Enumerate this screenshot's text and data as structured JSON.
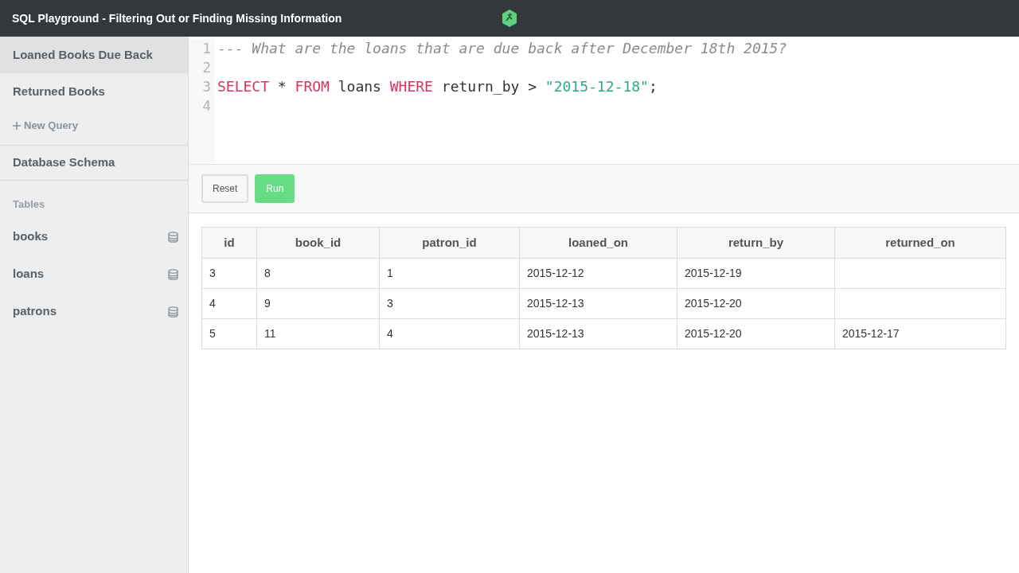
{
  "window": {
    "title": "SQL Playground - Filtering Out or Finding Missing Information"
  },
  "sidebar": {
    "queries": [
      {
        "label": "Loaned Books Due Back",
        "selected": true
      },
      {
        "label": "Returned Books",
        "selected": false
      }
    ],
    "new_query": "New Query",
    "schema_title": "Database Schema",
    "tables_heading": "Tables",
    "tables": [
      "books",
      "loans",
      "patrons"
    ]
  },
  "editor": {
    "lines": [
      {
        "number": "1",
        "tokens": [
          {
            "kind": "comment",
            "text": "--- What are the loans that are due back after December 18th 2015?"
          }
        ]
      },
      {
        "number": "2"
      },
      {
        "number": "3",
        "tokens": [
          {
            "kind": "keyword",
            "text": "SELECT"
          },
          {
            "kind": "plain",
            "text": " * "
          },
          {
            "kind": "keyword",
            "text": "FROM"
          },
          {
            "kind": "plain",
            "text": " loans "
          },
          {
            "kind": "keyword",
            "text": "WHERE"
          },
          {
            "kind": "plain",
            "text": " return_by > "
          },
          {
            "kind": "string",
            "text": "\"2015-12-18\""
          },
          {
            "kind": "plain",
            "text": ";"
          }
        ]
      },
      {
        "number": "4"
      }
    ]
  },
  "buttons": {
    "reset": "Reset",
    "run": "Run"
  },
  "table": {
    "columns": [
      "id",
      "book_id",
      "patron_id",
      "loaned_on",
      "return_by",
      "returned_on"
    ],
    "rows": [
      [
        "3",
        "8",
        "1",
        "2015-12-12",
        "2015-12-19",
        null
      ],
      [
        "4",
        "9",
        "3",
        "2015-12-13",
        "2015-12-20",
        null
      ],
      [
        "5",
        "11",
        "4",
        "2015-12-13",
        "2015-12-20",
        "2015-12-17"
      ]
    ]
  }
}
